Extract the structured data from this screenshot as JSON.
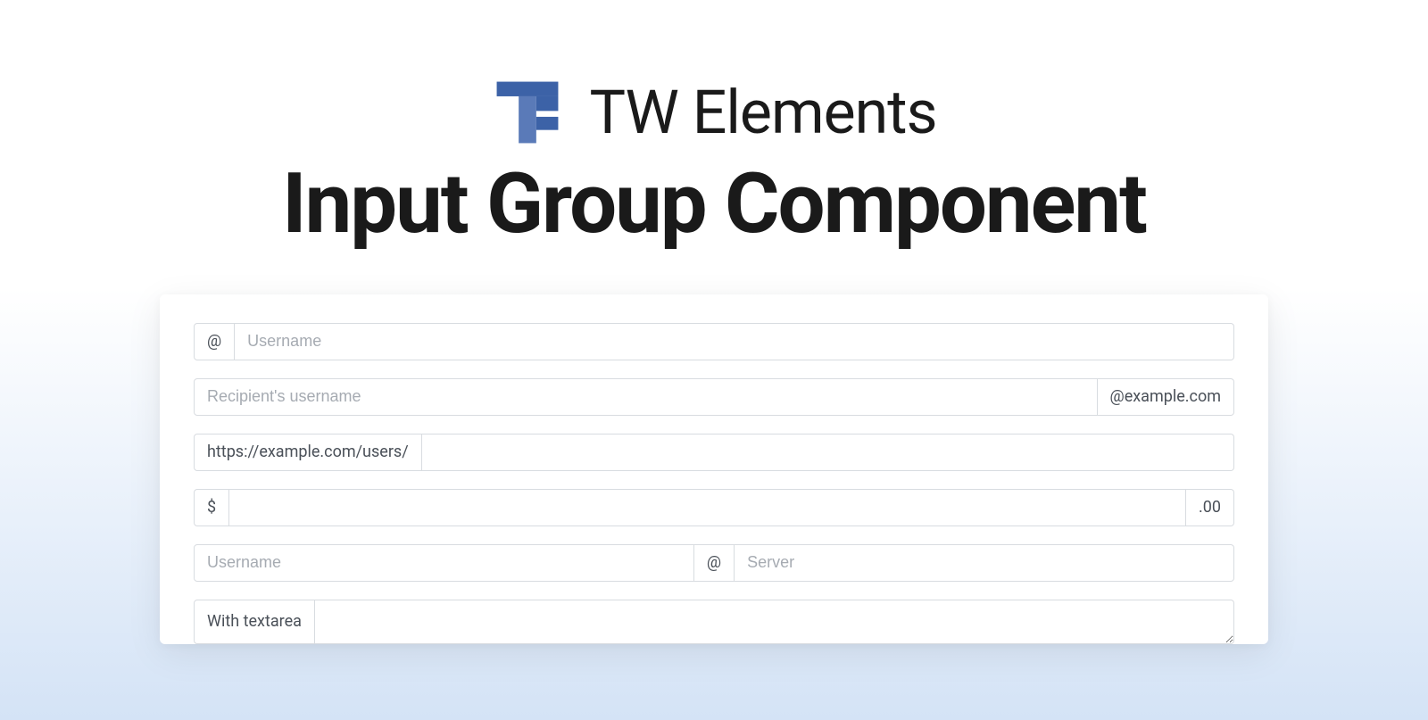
{
  "brand": {
    "name": "TW Elements",
    "logo_color_dark": "#3c62a7",
    "logo_color_light": "#5a7ab8"
  },
  "title": "Input Group Component",
  "groups": {
    "g1": {
      "prefix": "@",
      "placeholder": "Username"
    },
    "g2": {
      "placeholder": "Recipient's username",
      "suffix": "@example.com"
    },
    "g3": {
      "prefix": "https://example.com/users/"
    },
    "g4": {
      "prefix": "$",
      "suffix": ".00"
    },
    "g5": {
      "placeholder_left": "Username",
      "middle": "@",
      "placeholder_right": "Server"
    },
    "g6": {
      "prefix": "With textarea"
    }
  }
}
